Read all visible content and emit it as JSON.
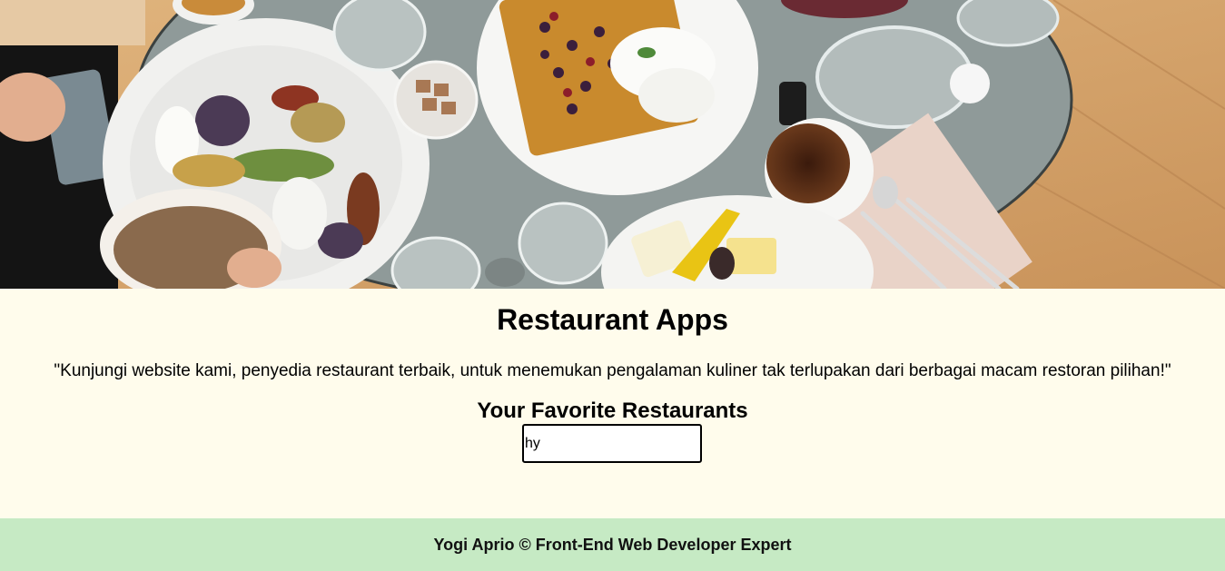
{
  "hero": {
    "image_name": "restaurant-table-hero-image"
  },
  "main": {
    "title": "Restaurant Apps",
    "tagline": "\"Kunjungi website kami, penyedia restaurant terbaik, untuk menemukan pengalaman kuliner tak terlupakan dari berbagai macam restoran pilihan!\"",
    "favorites_heading": "Your Favorite Restaurants",
    "search": {
      "value": "hy",
      "placeholder": ""
    }
  },
  "footer": {
    "text": "Yogi Aprio © Front-End Web Developer Expert"
  },
  "colors": {
    "page_background": "#fffcec",
    "footer_background": "#c6eac4",
    "table_top": "#8f9a99",
    "floor_wood": "#d6a96f"
  }
}
